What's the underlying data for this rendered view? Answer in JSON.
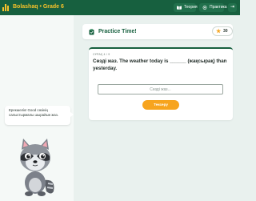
{
  "brand": {
    "text": "Bolashaq • Grade 6",
    "accent": "#f7c22a"
  },
  "topnav": {
    "theory_label": "Теория",
    "practice_label": "Практика",
    "logout_icon": "logout-icon"
  },
  "sidebar": {
    "bubble_text": "Ерекшелік! Good сөзінің салыстырмалы шырайын жаз.",
    "mascot_icon": "raccoon-mascot"
  },
  "header": {
    "title": "Practice Time!",
    "icon": "clipboard-icon",
    "score": "30",
    "score_icon": "star-icon"
  },
  "question": {
    "counter": "СҰРАҚ 4 / 9",
    "text": "Сөзді жаз. The weather today is ______ (жақсырақ) than yesterday.",
    "input_placeholder": "Сөзді жаз...",
    "input_value": "",
    "check_label": "Тексеру"
  },
  "colors": {
    "primary": "#17603f",
    "button": "#f7a41e",
    "background": "#e9f1ee"
  }
}
